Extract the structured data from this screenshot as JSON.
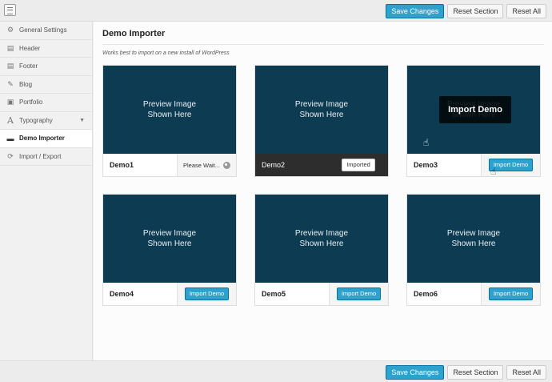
{
  "toolbar": {
    "save_label": "Save Changes",
    "reset_section_label": "Reset Section",
    "reset_all_label": "Reset All"
  },
  "sidebar": {
    "items": [
      {
        "label": "General Settings",
        "icon": "gear-icon"
      },
      {
        "label": "Header",
        "icon": "header-icon"
      },
      {
        "label": "Footer",
        "icon": "footer-icon"
      },
      {
        "label": "Blog",
        "icon": "pencil-icon"
      },
      {
        "label": "Portfolio",
        "icon": "image-icon"
      },
      {
        "label": "Typography",
        "icon": "font-icon"
      },
      {
        "label": "Demo Importer",
        "icon": "monitor-icon"
      },
      {
        "label": "Import / Export",
        "icon": "refresh-icon"
      }
    ]
  },
  "main": {
    "title": "Demo Importer",
    "subtitle": "Works best to import on a new install of WordPress",
    "preview_line1": "Preview Image",
    "preview_line2": "Shown Here",
    "overlay_label": "Import Demo",
    "wait_label": "Please Wait...",
    "imported_label": "Imported",
    "import_label": "Import Demo",
    "demos": [
      {
        "name": "Demo1",
        "state": "importing"
      },
      {
        "name": "Demo2",
        "state": "imported"
      },
      {
        "name": "Demo3",
        "state": "hover"
      },
      {
        "name": "Demo4",
        "state": "available"
      },
      {
        "name": "Demo5",
        "state": "available"
      },
      {
        "name": "Demo6",
        "state": "available"
      }
    ]
  },
  "colors": {
    "accent": "#2ea2cc",
    "preview_bg": "#0c3b52",
    "imported_footer": "#2d2d2d"
  }
}
